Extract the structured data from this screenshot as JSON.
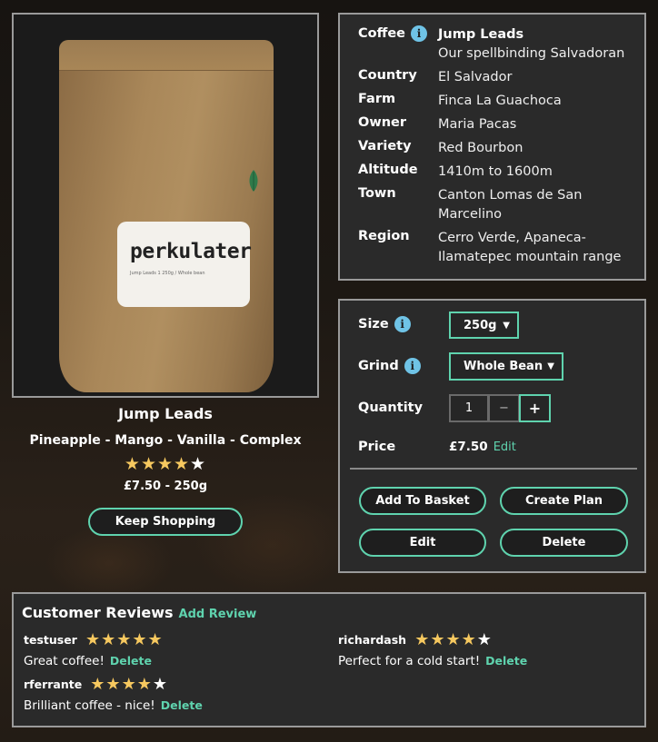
{
  "product": {
    "bag_brand": "perkulater",
    "bag_fine_print": "Jump Leads 1 250g / Whole bean",
    "title": "Jump Leads",
    "notes": "Pineapple - Mango - Vanilla - Complex",
    "rating": 4,
    "rating_max": 5,
    "stars_text": "★★★★",
    "stars_empty_text": "★",
    "price_size": "£7.50 - 250g",
    "keep_shopping_label": "Keep Shopping"
  },
  "details": {
    "rows": [
      {
        "label": "Coffee",
        "value": "Jump Leads",
        "subvalue": "Our spellbinding Salvadoran",
        "info_icon": "info-icon"
      },
      {
        "label": "Country",
        "value": "El Salvador"
      },
      {
        "label": "Farm",
        "value": "Finca La Guachoca"
      },
      {
        "label": "Owner",
        "value": "Maria Pacas"
      },
      {
        "label": "Variety",
        "value": "Red Bourbon"
      },
      {
        "label": "Altitude",
        "value": "1410m to 1600m"
      },
      {
        "label": "Town",
        "value": "Canton Lomas de San Marcelino"
      },
      {
        "label": "Region",
        "value": "Cerro Verde, Apaneca-Ilamatepec mountain range"
      }
    ]
  },
  "purchase": {
    "size_label": "Size",
    "size_value": "250g",
    "grind_label": "Grind",
    "grind_value": "Whole Bean",
    "quantity_label": "Quantity",
    "quantity_value": "1",
    "minus": "−",
    "plus": "+",
    "price_label": "Price",
    "price_value": "£7.50",
    "price_edit": "Edit",
    "add_to_basket": "Add To Basket",
    "create_plan": "Create Plan",
    "edit": "Edit",
    "delete": "Delete",
    "info_glyph": "i"
  },
  "reviews": {
    "title": "Customer Reviews",
    "add_review": "Add Review",
    "delete_label": "Delete",
    "items": [
      {
        "user": "testuser",
        "rating": 5,
        "stars_full": "★★★★★",
        "stars_empty": "",
        "text": "Great coffee!"
      },
      {
        "user": "rferrante",
        "rating": 4,
        "stars_full": "★★★★",
        "stars_empty": "★",
        "text": "Brilliant coffee - nice!"
      },
      {
        "user": "richardash",
        "rating": 4,
        "stars_full": "★★★★",
        "stars_empty": "★",
        "text": "Perfect for a cold start!"
      }
    ]
  },
  "colors": {
    "accent": "#5fd3ae",
    "star": "#f6c85f",
    "info": "#6fc3e6",
    "panel": "#2a2a2a",
    "border": "#9a9a9a"
  }
}
